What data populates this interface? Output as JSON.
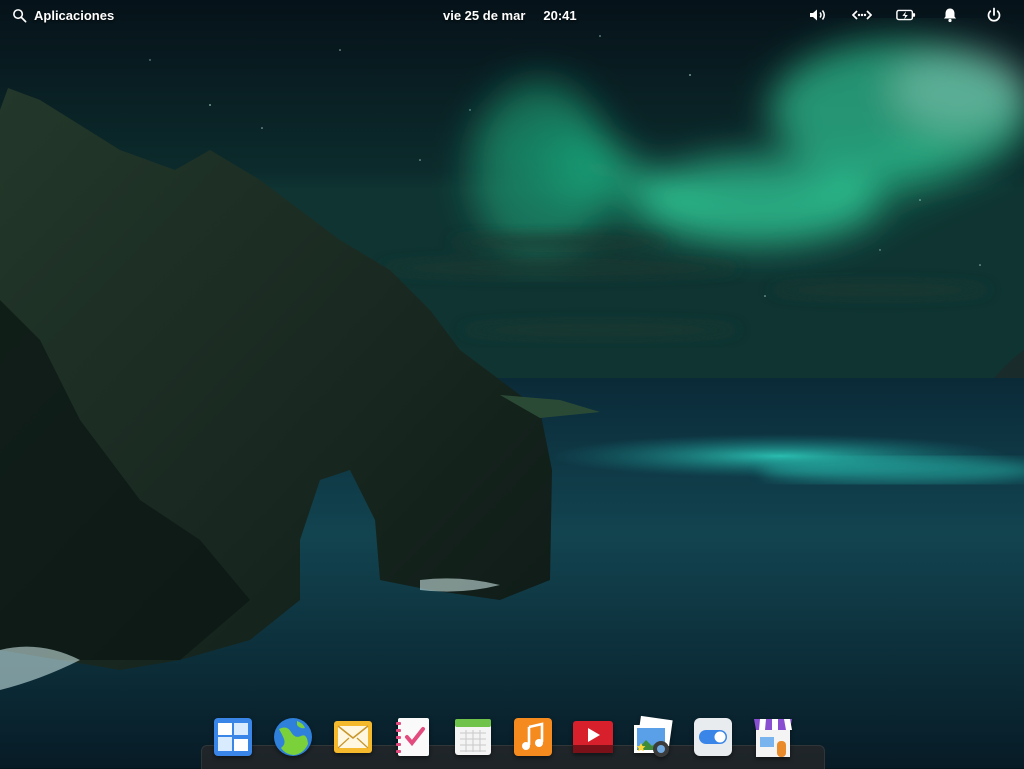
{
  "panel": {
    "applications_label": "Aplicaciones",
    "date": "vie 25 de mar",
    "time": "20:41",
    "indicators": [
      "sound-icon",
      "network-icon",
      "battery-charging-icon",
      "notifications-icon",
      "power-icon"
    ]
  },
  "dock": {
    "apps": [
      "multitasking-view",
      "web-browser",
      "mail",
      "tasks",
      "calendar",
      "music",
      "videos",
      "photos",
      "system-settings",
      "appcenter"
    ]
  },
  "colors": {
    "aurora": "#3df2b2",
    "sea": "#0a2a35",
    "sky": "#071a22",
    "dock_bg": "#282828"
  }
}
